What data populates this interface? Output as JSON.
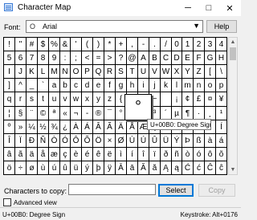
{
  "titlebar": {
    "title": "Character Map",
    "minimize": "─",
    "maximize": "□",
    "close": "✕"
  },
  "font": {
    "label": "Font:",
    "selected": "Arial",
    "font_icon": "O",
    "help_label": "Help"
  },
  "grid": {
    "rows": [
      [
        "!",
        "\"",
        "#",
        "$",
        "%",
        "&",
        "'",
        "(",
        ")",
        "*",
        "+",
        ",",
        "-",
        ".",
        "/",
        "0",
        "1",
        "2",
        "3",
        "4"
      ],
      [
        "5",
        "6",
        "7",
        "8",
        "9",
        ":",
        ";",
        "<",
        "=",
        ">",
        "?",
        "@",
        "A",
        "B",
        "C",
        "D",
        "E",
        "F",
        "G",
        "H"
      ],
      [
        "I",
        "J",
        "K",
        "L",
        "M",
        "N",
        "O",
        "P",
        "Q",
        "R",
        "S",
        "T",
        "U",
        "V",
        "W",
        "X",
        "Y",
        "Z",
        "[",
        "\\"
      ],
      [
        "]",
        "^",
        "_",
        "`",
        "a",
        "b",
        "c",
        "d",
        "e",
        "f",
        "g",
        "h",
        "i",
        "j",
        "k",
        "l",
        "m",
        "n",
        "o",
        "p"
      ],
      [
        "q",
        "r",
        "s",
        "t",
        "u",
        "v",
        "w",
        "x",
        "y",
        "z",
        "{",
        "|",
        "}",
        "~",
        " ",
        "¡",
        "¢",
        "£",
        "¤",
        "¥"
      ],
      [
        "¦",
        "§",
        "¨",
        "©",
        "ª",
        "«",
        "¬",
        "-",
        "®",
        "¯",
        "°",
        "±",
        "²",
        "³",
        "´",
        "µ",
        "¶",
        "·",
        "¸",
        "¹"
      ],
      [
        "º",
        "»",
        "¼",
        "½",
        "¾",
        "¿",
        "À",
        "Á",
        "Â",
        "Ã",
        "Ä",
        "Å",
        "Æ",
        "Ç",
        "È",
        "É",
        "Ê",
        "Ë",
        "Ì",
        "Í"
      ],
      [
        "Î",
        "Ï",
        "Ð",
        "Ñ",
        "Ò",
        "Ó",
        "Ô",
        "Õ",
        "Ö",
        "×",
        "Ø",
        "Ù",
        "Ú",
        "Û",
        "Ü",
        "Ý",
        "Þ",
        "ß",
        "à",
        "á"
      ],
      [
        "â",
        "ã",
        "ä",
        "å",
        "æ",
        "ç",
        "è",
        "é",
        "ê",
        "ë",
        "ì",
        "í",
        "î",
        "ï",
        "ð",
        "ñ",
        "ò",
        "ó",
        "ô",
        "õ"
      ],
      [
        "ö",
        "÷",
        "ø",
        "ù",
        "ú",
        "û",
        "ü",
        "ý",
        "þ",
        "ÿ",
        "Ā",
        "ā",
        "Ă",
        "ă",
        "Ą",
        "ą",
        "Ć",
        "ć",
        "Ĉ",
        "ĉ"
      ]
    ],
    "zoom_char": "°",
    "tooltip": "U+00B0: Degree Sign"
  },
  "copy": {
    "label": "Characters to copy:",
    "value": "",
    "select_label": "Select",
    "copy_label": "Copy"
  },
  "advanced": {
    "label": "Advanced view",
    "checked": false
  },
  "status": {
    "left": "U+00B0: Degree Sign",
    "right": "Keystroke: Alt+0176"
  },
  "scrollbar": {
    "up": "▲",
    "down": "▼"
  }
}
